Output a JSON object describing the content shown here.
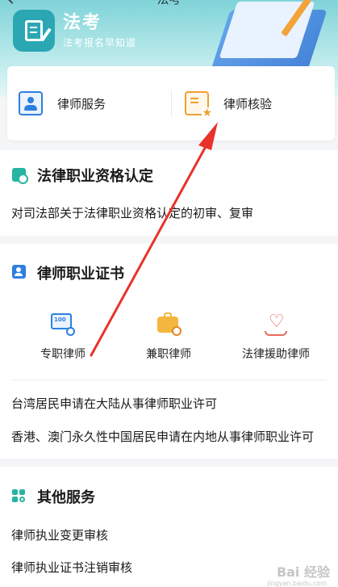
{
  "header": {
    "page_title": "法考"
  },
  "banner": {
    "title": "法考",
    "subtitle": "法考报名早知道"
  },
  "quick_links": [
    {
      "label": "律师服务"
    },
    {
      "label": "律师核验"
    }
  ],
  "section_qualification": {
    "title": "法律职业资格认定",
    "items": [
      "对司法部关于法律职业资格认定的初审、复审"
    ]
  },
  "section_certificate": {
    "title": "律师职业证书",
    "grid": [
      {
        "label": "专职律师"
      },
      {
        "label": "兼职律师"
      },
      {
        "label": "法律援助律师"
      }
    ],
    "items": [
      "台湾居民申请在大陆从事律师职业许可",
      "香港、澳门永久性中国居民申请在内地从事律师职业许可"
    ]
  },
  "section_other": {
    "title": "其他服务",
    "items": [
      "律师执业变更审核",
      "律师执业证书注销审核"
    ]
  },
  "watermark": {
    "text": "Bai 经验",
    "sub": "jingyan.baidu.com"
  },
  "colors": {
    "teal": "#27b4a0",
    "blue": "#2e7fe0",
    "orange": "#f0a030",
    "red_arrow": "#e8322a"
  }
}
